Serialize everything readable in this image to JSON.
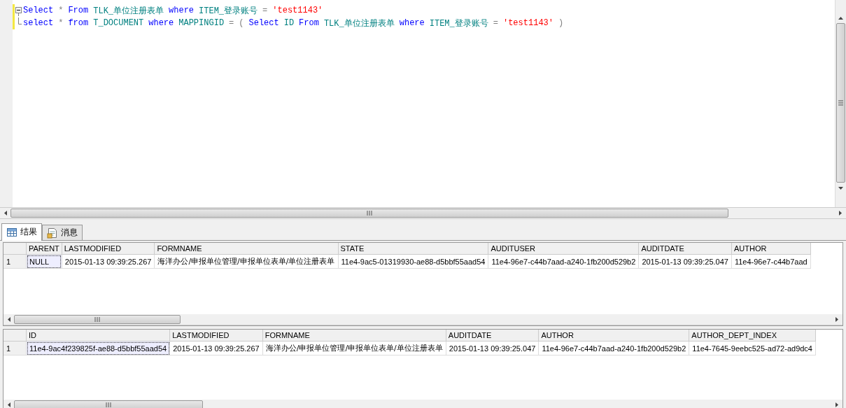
{
  "editor": {
    "lines": [
      {
        "kind": "fold_start",
        "tokens": [
          {
            "kind": "keyword",
            "text": "Select"
          },
          {
            "kind": "operator",
            "text": "*"
          },
          {
            "kind": "keyword",
            "text": "From"
          },
          {
            "kind": "ident",
            "text": "TLK_单位注册表单"
          },
          {
            "kind": "keyword",
            "text": "where"
          },
          {
            "kind": "ident",
            "text": "ITEM_登录账号"
          },
          {
            "kind": "operator",
            "text": "="
          },
          {
            "kind": "string",
            "text": "'test1143'"
          }
        ]
      },
      {
        "kind": "fold_end",
        "tokens": [
          {
            "kind": "keyword",
            "text": "select"
          },
          {
            "kind": "operator",
            "text": "*"
          },
          {
            "kind": "keyword",
            "text": "from"
          },
          {
            "kind": "ident",
            "text": "T_DOCUMENT"
          },
          {
            "kind": "keyword",
            "text": "where"
          },
          {
            "kind": "ident",
            "text": "MAPPINGID"
          },
          {
            "kind": "operator",
            "text": "="
          },
          {
            "kind": "operator",
            "text": "("
          },
          {
            "kind": "keyword",
            "text": "Select"
          },
          {
            "kind": "ident",
            "text": "ID"
          },
          {
            "kind": "keyword",
            "text": "From"
          },
          {
            "kind": "ident",
            "text": "TLK_单位注册表单"
          },
          {
            "kind": "keyword",
            "text": "where"
          },
          {
            "kind": "ident",
            "text": "ITEM_登录账号"
          },
          {
            "kind": "operator",
            "text": "="
          },
          {
            "kind": "string",
            "text": "'test1143'"
          },
          {
            "kind": "operator",
            "text": ")"
          }
        ]
      }
    ]
  },
  "tabs": [
    {
      "label": "结果",
      "kind": "grid",
      "selected": true
    },
    {
      "label": "消息",
      "kind": "messages",
      "selected": false
    }
  ],
  "grids": [
    {
      "columns": [
        "PARENT",
        "LASTMODIFIED",
        "FORMNAME",
        "STATE",
        "AUDITUSER",
        "AUDITDATE",
        "AUTHOR"
      ],
      "rows": [
        {
          "number": "1",
          "cells": [
            {
              "text": "NULL",
              "selected": true
            },
            {
              "text": "2015-01-13 09:39:25.267",
              "selected": false
            },
            {
              "text": "海洋办公/申报单位管理/申报单位表单/单位注册表单",
              "selected": false
            },
            {
              "text": "11e4-9ac5-01319930-ae88-d5bbf55aad54",
              "selected": false
            },
            {
              "text": "11e4-96e7-c44b7aad-a240-1fb200d529b2",
              "selected": false
            },
            {
              "text": "2015-01-13 09:39:25.047",
              "selected": false
            },
            {
              "text": "11e4-96e7-c44b7aad",
              "selected": false
            }
          ]
        }
      ]
    },
    {
      "columns": [
        "ID",
        "LASTMODIFIED",
        "FORMNAME",
        "AUDITDATE",
        "AUTHOR",
        "AUTHOR_DEPT_INDEX"
      ],
      "rows": [
        {
          "number": "1",
          "cells": [
            {
              "text": "11e4-9ac4f239825f-ae88-d5bbf55aad54",
              "selected": true
            },
            {
              "text": "2015-01-13 09:39:25.267",
              "selected": false
            },
            {
              "text": "海洋办公/申报单位管理/申报单位表单/单位注册表单",
              "selected": false
            },
            {
              "text": "2015-01-13 09:39:25.047",
              "selected": false
            },
            {
              "text": "11e4-96e7-c44b7aad-a240-1fb200d529b2",
              "selected": false
            },
            {
              "text": "11e4-7645-9eebc525-ad72-ad9dc4",
              "selected": false
            }
          ]
        }
      ]
    }
  ]
}
